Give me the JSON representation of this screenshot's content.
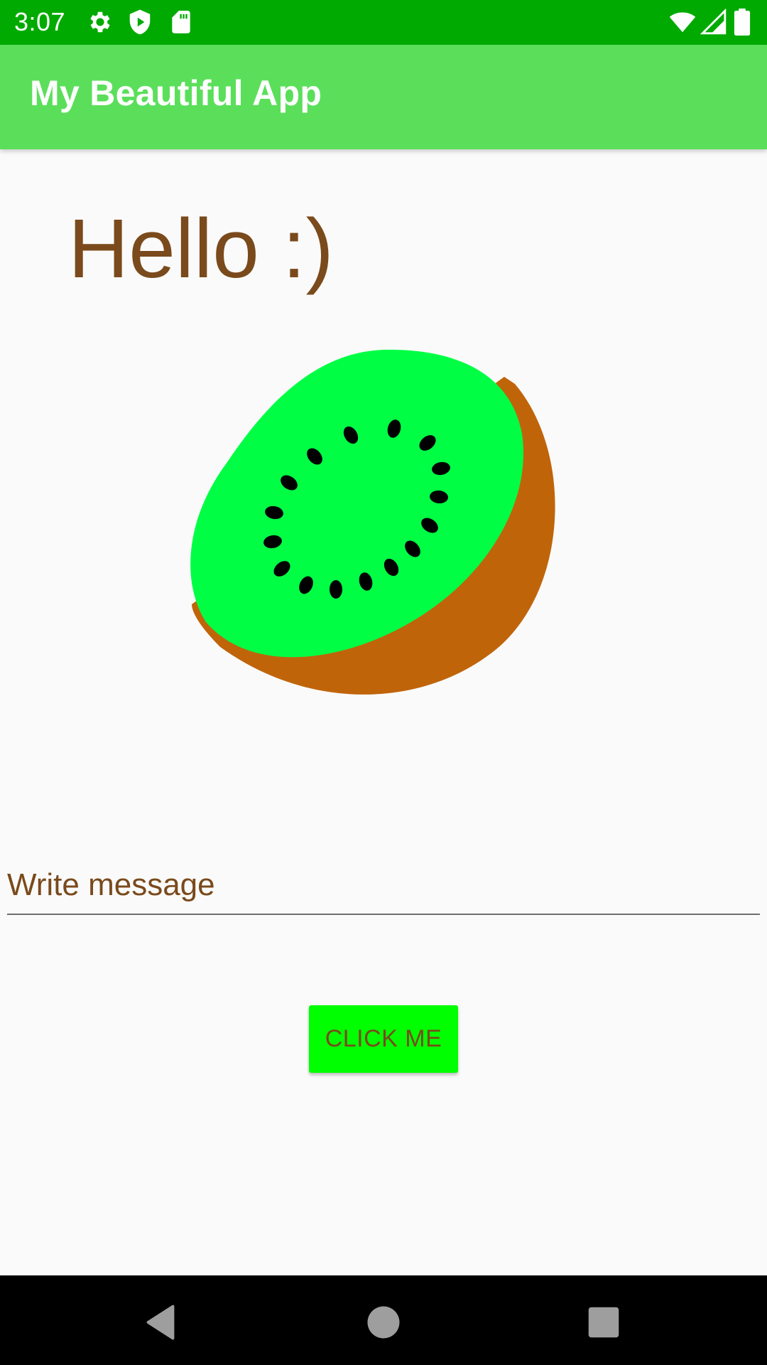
{
  "status_bar": {
    "time": "3:07",
    "left_icons": [
      "gear-icon",
      "shield-play-icon",
      "sd-card-icon"
    ],
    "right_icons": [
      "wifi-icon",
      "cell-signal-icon",
      "battery-icon"
    ],
    "background_color": "#00aa00"
  },
  "app_bar": {
    "title": "My Beautiful App",
    "background_color": "#5bdf5b"
  },
  "main": {
    "greeting": "Hello :)",
    "image": "kiwi-illustration",
    "message_input": {
      "placeholder": "Write message",
      "value": ""
    },
    "button_label": "CLICK ME",
    "text_color": "#7a4a1c",
    "button_color": "#00ff00"
  },
  "nav_bar": {
    "buttons": [
      "back-icon",
      "home-icon",
      "recents-icon"
    ]
  }
}
